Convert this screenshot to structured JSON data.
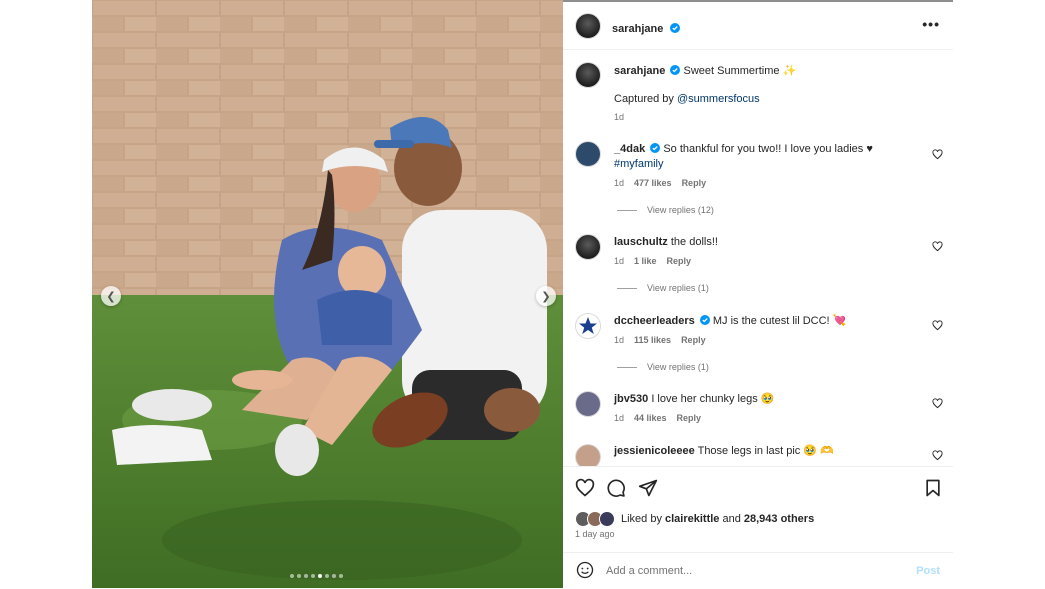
{
  "post": {
    "author": "sarahjane",
    "caption_text": "Sweet Summertime ✨",
    "captured_by_prefix": "Captured by ",
    "captured_by_handle": "@summersfocus",
    "caption_age": "1d",
    "more_icon": "•••"
  },
  "comments": [
    {
      "user": "_4dak",
      "verified": true,
      "text": "So thankful for you two!! I love you ladies ♥",
      "text2": "#myfamily",
      "age": "1d",
      "likes": "477 likes",
      "reply": "Reply",
      "view_replies": "View replies (12)",
      "avatar_color": "#2d4a6b"
    },
    {
      "user": "lauschultz",
      "verified": false,
      "text": "the dolls!!",
      "age": "1d",
      "likes": "1 like",
      "reply": "Reply",
      "view_replies": "View replies (1)",
      "avatar_color": "#3a3a3a"
    },
    {
      "user": "dccheerleaders",
      "verified": true,
      "text": "MJ is the cutest lil DCC! 💘",
      "age": "1d",
      "likes": "115 likes",
      "reply": "Reply",
      "view_replies": "View replies (1)",
      "avatar_color": "#ffffff"
    },
    {
      "user": "jbv530",
      "verified": false,
      "text": "I love her chunky legs 🥹",
      "age": "1d",
      "likes": "44 likes",
      "reply": "Reply",
      "avatar_color": "#6a6a8a"
    },
    {
      "user": "jessienicoleeee",
      "verified": false,
      "text": "Those legs in last pic 🥹 🫶",
      "avatar_color": "#c4a08a"
    }
  ],
  "likes": {
    "prefix": "Liked by ",
    "user": "clairekittle",
    "and": " and ",
    "count": "28,943 others"
  },
  "time_ago": "1 day ago",
  "add_comment": {
    "placeholder": "Add a comment...",
    "post_label": "Post"
  },
  "colors": {
    "verified": "#0095f6",
    "link": "#00376b",
    "post_disabled": "#b2dffc"
  },
  "icons": [
    "heart-icon",
    "comment-icon",
    "share-icon",
    "bookmark-icon",
    "emoji-icon",
    "more-icon",
    "chevron-left-icon",
    "chevron-right-icon"
  ]
}
